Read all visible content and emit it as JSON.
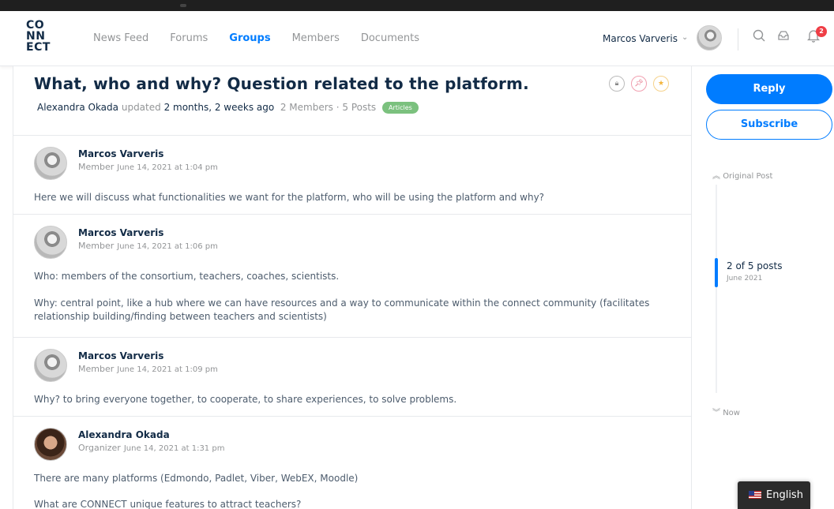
{
  "logo": {
    "line1": "CO",
    "line2": "NN",
    "line3": "ECT"
  },
  "nav": {
    "items": [
      {
        "label": "News Feed",
        "active": false
      },
      {
        "label": "Forums",
        "active": false
      },
      {
        "label": "Groups",
        "active": true
      },
      {
        "label": "Members",
        "active": false
      },
      {
        "label": "Documents",
        "active": false
      }
    ],
    "user_name": "Marcos Varveris",
    "notification_count": "2"
  },
  "topic": {
    "title": "What, who and why? Question related to the platform.",
    "author": "Alexandra Okada",
    "updated_label": "updated",
    "updated_time": "2 months, 2 weeks ago",
    "stats": "2 Members · 5 Posts",
    "tag": "Articles"
  },
  "replies": [
    {
      "name": "Marcos Varveris",
      "role": "Member",
      "date": "June 14, 2021 at 1:04 pm",
      "paragraphs": [
        "Here we will discuss what functionalities we want for the platform, who will be using the platform and why?"
      ]
    },
    {
      "name": "Marcos Varveris",
      "role": "Member",
      "date": "June 14, 2021 at 1:06 pm",
      "paragraphs": [
        "Who: members of the consortium, teachers, coaches, scientists.",
        "Why: central point, like a hub where we can have resources and a way to communicate within the connect community (facilitates",
        "relationship building/finding between teachers and scientists)"
      ]
    },
    {
      "name": "Marcos Varveris",
      "role": "Member",
      "date": "June 14, 2021 at 1:09 pm",
      "paragraphs": [
        "Why? to bring everyone together, to cooperate, to share experiences, to solve problems."
      ]
    },
    {
      "name": "Alexandra Okada",
      "role": "Organizer",
      "date": "June 14, 2021 at 1:31 pm",
      "paragraphs": [
        "There are many platforms (Edmondo, Padlet, Viber, WebEX, Moodle)",
        "What are CONNECT unique features to attract teachers?"
      ]
    }
  ],
  "sidebar": {
    "reply_label": "Reply",
    "subscribe_label": "Subscribe",
    "timeline_top": "Original Post",
    "timeline_current": "2 of 5 posts",
    "timeline_date": "June 2021",
    "timeline_bottom": "Now"
  },
  "language": {
    "label": "English"
  }
}
